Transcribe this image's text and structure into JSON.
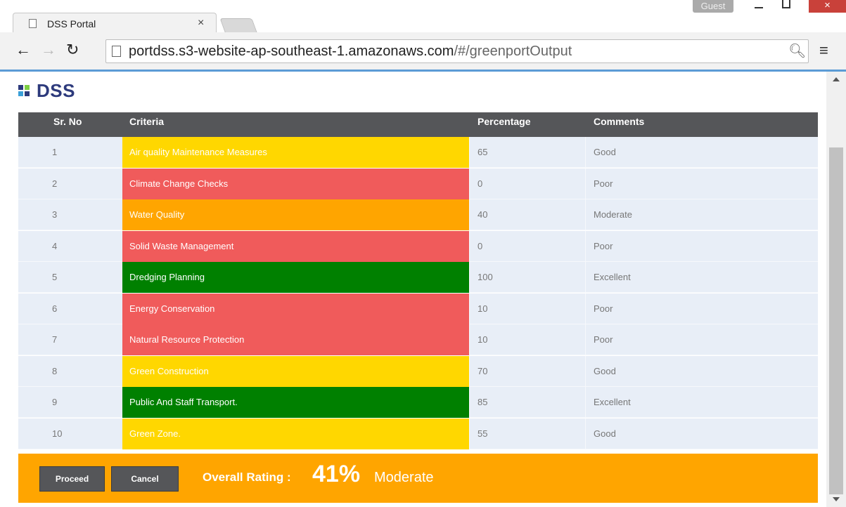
{
  "browser": {
    "tab_title": "DSS Portal",
    "tab_close": "×",
    "guest_label": "Guest",
    "close_symbol": "×",
    "url_host": "portdss.s3-website-ap-southeast-1.amazonaws.com",
    "url_path": "/#/greenportOutput"
  },
  "header": {
    "brand": "DSS"
  },
  "table": {
    "columns": [
      "Sr. No",
      "Criteria",
      "Percentage",
      "Comments"
    ],
    "rows": [
      {
        "sr": "1",
        "criteria": "Air quality Maintenance Measures",
        "percentage": "65",
        "comment": "Good",
        "color": "#ffd700"
      },
      {
        "sr": "2",
        "criteria": "Climate Change Checks",
        "percentage": "0",
        "comment": "Poor",
        "color": "#f05b5b"
      },
      {
        "sr": "3",
        "criteria": "Water Quality",
        "percentage": "40",
        "comment": "Moderate",
        "color": "#ffa500"
      },
      {
        "sr": "4",
        "criteria": "Solid Waste Management",
        "percentage": "0",
        "comment": "Poor",
        "color": "#f05b5b"
      },
      {
        "sr": "5",
        "criteria": "Dredging Planning",
        "percentage": "100",
        "comment": "Excellent",
        "color": "#008000"
      },
      {
        "sr": "6",
        "criteria": "Energy Conservation",
        "percentage": "10",
        "comment": "Poor",
        "color": "#f05b5b"
      },
      {
        "sr": "7",
        "criteria": "Natural Resource Protection",
        "percentage": "10",
        "comment": "Poor",
        "color": "#f05b5b"
      },
      {
        "sr": "8",
        "criteria": "Green Construction",
        "percentage": "70",
        "comment": "Good",
        "color": "#ffd700"
      },
      {
        "sr": "9",
        "criteria": "Public And Staff Transport.",
        "percentage": "85",
        "comment": "Excellent",
        "color": "#008000"
      },
      {
        "sr": "10",
        "criteria": "Green Zone.",
        "percentage": "55",
        "comment": "Good",
        "color": "#ffd700"
      }
    ]
  },
  "footer": {
    "proceed_label": "Proceed",
    "cancel_label": "Cancel",
    "overall_label": "Overall Rating :",
    "overall_percentage": "41%",
    "overall_text": "Moderate",
    "background": "#ffa500"
  }
}
